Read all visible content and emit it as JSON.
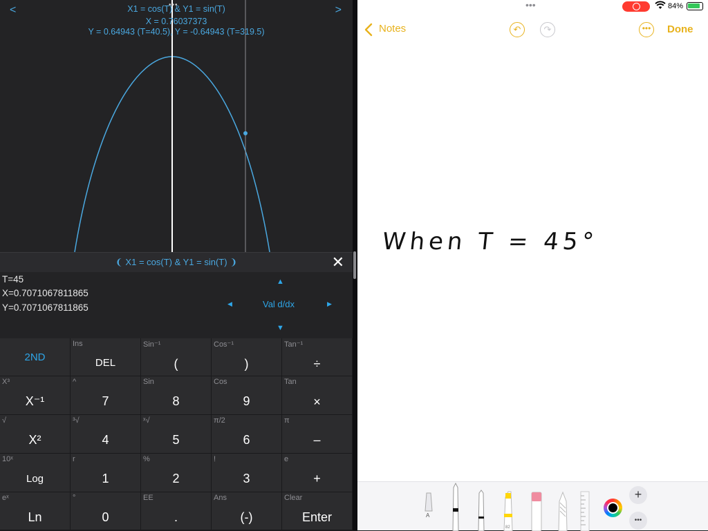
{
  "graph": {
    "nav_prev": "<",
    "nav_next": ">",
    "title": "X1 = cos(T) & Y1 = sin(T)",
    "x_readout": "X = 0.76037373",
    "y_readout": "Y = 0.64943 (T=40.5), Y = -0.64943 (T=319.5)",
    "multitask": "•••"
  },
  "function_bar": {
    "title": "❨ X1 = cos(T) & Y1 = sin(T) ❩",
    "close_label": "✕"
  },
  "results": {
    "t_line": "T=45",
    "x_line": "X=0.7071067811865",
    "y_line": "Y=0.7071067811865",
    "mode_label": "Val d/dx",
    "up": "▲",
    "down": "▼",
    "left": "◀",
    "right": "▶"
  },
  "keypad": {
    "rows": [
      [
        {
          "main": "2ND",
          "sec": ""
        },
        {
          "main": "DEL",
          "sec": "Ins"
        },
        {
          "main": "(",
          "sec": "Sin⁻¹"
        },
        {
          "main": ")",
          "sec": "Cos⁻¹"
        },
        {
          "main": "÷",
          "sec": "Tan⁻¹"
        }
      ],
      [
        {
          "main": "X⁻¹",
          "sec": "X³"
        },
        {
          "main": "7",
          "sec": "^"
        },
        {
          "main": "8",
          "sec": "Sin"
        },
        {
          "main": "9",
          "sec": "Cos"
        },
        {
          "main": "×",
          "sec": "Tan"
        }
      ],
      [
        {
          "main": "X²",
          "sec": "√"
        },
        {
          "main": "4",
          "sec": "³√"
        },
        {
          "main": "5",
          "sec": "ˣ√"
        },
        {
          "main": "6",
          "sec": "π/2"
        },
        {
          "main": "–",
          "sec": "π"
        }
      ],
      [
        {
          "main": "Log",
          "sec": "10ˣ"
        },
        {
          "main": "1",
          "sec": "r"
        },
        {
          "main": "2",
          "sec": "%"
        },
        {
          "main": "3",
          "sec": "!"
        },
        {
          "main": "+",
          "sec": "e"
        }
      ],
      [
        {
          "main": "Ln",
          "sec": "eˣ"
        },
        {
          "main": "0",
          "sec": "°"
        },
        {
          "main": ".",
          "sec": "EE"
        },
        {
          "main": "(-)",
          "sec": "Ans"
        },
        {
          "main": "Enter",
          "sec": "Clear"
        }
      ]
    ]
  },
  "status_bar": {
    "dots": "•••",
    "battery": "84%"
  },
  "notes": {
    "back_label": "Notes",
    "done_label": "Done",
    "handwriting": "When T = 45°",
    "accent_color": "#e8b21c"
  },
  "toolbar": {
    "add_label": "+",
    "more_label": "•••"
  }
}
